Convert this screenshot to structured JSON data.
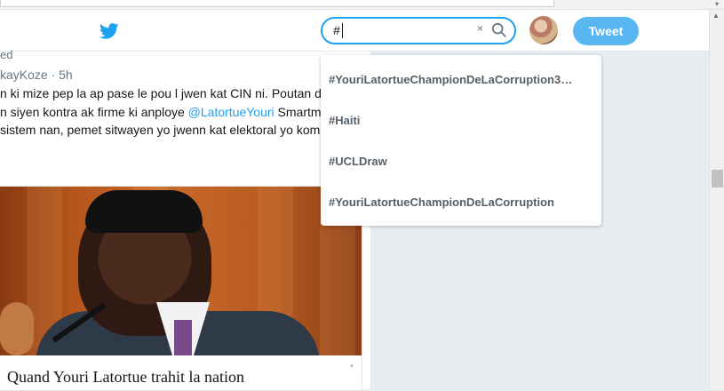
{
  "header": {
    "search_value": "#",
    "clear_icon": "×",
    "tweet_button": "Tweet"
  },
  "tweet": {
    "context_partial": "ed",
    "handle_line": "kayKoze · 5h",
    "line1": "n ki mize pep la ap pase le pou l jwen kat CIN ni. Poutan de",
    "line2_before": "n siyen kontra ak firme ki anploye ",
    "line2_mention": "@LatortueYouri",
    "line2_after": " Smartma",
    "line3": " sistem nan, pemet sitwayen yo jwenn kat elektoral yo kom",
    "card_title": "Quand Youri Latortue trahit la nation"
  },
  "suggestions": [
    "#YouriLatortueChampionDeLaCorruption3…",
    "#Haiti",
    "#UCLDraw",
    "#YouriLatortueChampionDeLaCorruption"
  ],
  "colors": {
    "accent": "#1da1f2",
    "tweet_button_bg": "#58b7f0",
    "page_bg": "#e6ecf0"
  },
  "icons": {
    "logo": "twitter-bird-icon",
    "search": "search-icon",
    "clear": "close-icon"
  }
}
